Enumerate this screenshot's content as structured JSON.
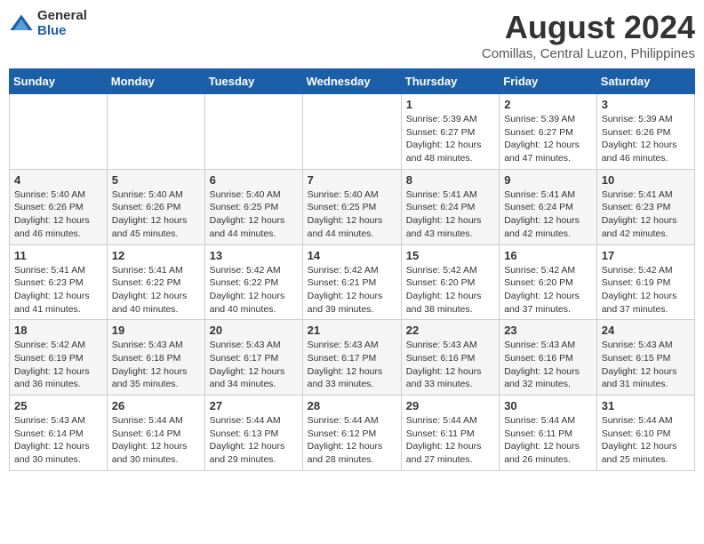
{
  "header": {
    "logo_general": "General",
    "logo_blue": "Blue",
    "main_title": "August 2024",
    "subtitle": "Comillas, Central Luzon, Philippines"
  },
  "calendar": {
    "days_of_week": [
      "Sunday",
      "Monday",
      "Tuesday",
      "Wednesday",
      "Thursday",
      "Friday",
      "Saturday"
    ],
    "weeks": [
      [
        {
          "day": "",
          "info": ""
        },
        {
          "day": "",
          "info": ""
        },
        {
          "day": "",
          "info": ""
        },
        {
          "day": "",
          "info": ""
        },
        {
          "day": "1",
          "info": "Sunrise: 5:39 AM\nSunset: 6:27 PM\nDaylight: 12 hours\nand 48 minutes."
        },
        {
          "day": "2",
          "info": "Sunrise: 5:39 AM\nSunset: 6:27 PM\nDaylight: 12 hours\nand 47 minutes."
        },
        {
          "day": "3",
          "info": "Sunrise: 5:39 AM\nSunset: 6:26 PM\nDaylight: 12 hours\nand 46 minutes."
        }
      ],
      [
        {
          "day": "4",
          "info": "Sunrise: 5:40 AM\nSunset: 6:26 PM\nDaylight: 12 hours\nand 46 minutes."
        },
        {
          "day": "5",
          "info": "Sunrise: 5:40 AM\nSunset: 6:26 PM\nDaylight: 12 hours\nand 45 minutes."
        },
        {
          "day": "6",
          "info": "Sunrise: 5:40 AM\nSunset: 6:25 PM\nDaylight: 12 hours\nand 44 minutes."
        },
        {
          "day": "7",
          "info": "Sunrise: 5:40 AM\nSunset: 6:25 PM\nDaylight: 12 hours\nand 44 minutes."
        },
        {
          "day": "8",
          "info": "Sunrise: 5:41 AM\nSunset: 6:24 PM\nDaylight: 12 hours\nand 43 minutes."
        },
        {
          "day": "9",
          "info": "Sunrise: 5:41 AM\nSunset: 6:24 PM\nDaylight: 12 hours\nand 42 minutes."
        },
        {
          "day": "10",
          "info": "Sunrise: 5:41 AM\nSunset: 6:23 PM\nDaylight: 12 hours\nand 42 minutes."
        }
      ],
      [
        {
          "day": "11",
          "info": "Sunrise: 5:41 AM\nSunset: 6:23 PM\nDaylight: 12 hours\nand 41 minutes."
        },
        {
          "day": "12",
          "info": "Sunrise: 5:41 AM\nSunset: 6:22 PM\nDaylight: 12 hours\nand 40 minutes."
        },
        {
          "day": "13",
          "info": "Sunrise: 5:42 AM\nSunset: 6:22 PM\nDaylight: 12 hours\nand 40 minutes."
        },
        {
          "day": "14",
          "info": "Sunrise: 5:42 AM\nSunset: 6:21 PM\nDaylight: 12 hours\nand 39 minutes."
        },
        {
          "day": "15",
          "info": "Sunrise: 5:42 AM\nSunset: 6:20 PM\nDaylight: 12 hours\nand 38 minutes."
        },
        {
          "day": "16",
          "info": "Sunrise: 5:42 AM\nSunset: 6:20 PM\nDaylight: 12 hours\nand 37 minutes."
        },
        {
          "day": "17",
          "info": "Sunrise: 5:42 AM\nSunset: 6:19 PM\nDaylight: 12 hours\nand 37 minutes."
        }
      ],
      [
        {
          "day": "18",
          "info": "Sunrise: 5:42 AM\nSunset: 6:19 PM\nDaylight: 12 hours\nand 36 minutes."
        },
        {
          "day": "19",
          "info": "Sunrise: 5:43 AM\nSunset: 6:18 PM\nDaylight: 12 hours\nand 35 minutes."
        },
        {
          "day": "20",
          "info": "Sunrise: 5:43 AM\nSunset: 6:17 PM\nDaylight: 12 hours\nand 34 minutes."
        },
        {
          "day": "21",
          "info": "Sunrise: 5:43 AM\nSunset: 6:17 PM\nDaylight: 12 hours\nand 33 minutes."
        },
        {
          "day": "22",
          "info": "Sunrise: 5:43 AM\nSunset: 6:16 PM\nDaylight: 12 hours\nand 33 minutes."
        },
        {
          "day": "23",
          "info": "Sunrise: 5:43 AM\nSunset: 6:16 PM\nDaylight: 12 hours\nand 32 minutes."
        },
        {
          "day": "24",
          "info": "Sunrise: 5:43 AM\nSunset: 6:15 PM\nDaylight: 12 hours\nand 31 minutes."
        }
      ],
      [
        {
          "day": "25",
          "info": "Sunrise: 5:43 AM\nSunset: 6:14 PM\nDaylight: 12 hours\nand 30 minutes."
        },
        {
          "day": "26",
          "info": "Sunrise: 5:44 AM\nSunset: 6:14 PM\nDaylight: 12 hours\nand 30 minutes."
        },
        {
          "day": "27",
          "info": "Sunrise: 5:44 AM\nSunset: 6:13 PM\nDaylight: 12 hours\nand 29 minutes."
        },
        {
          "day": "28",
          "info": "Sunrise: 5:44 AM\nSunset: 6:12 PM\nDaylight: 12 hours\nand 28 minutes."
        },
        {
          "day": "29",
          "info": "Sunrise: 5:44 AM\nSunset: 6:11 PM\nDaylight: 12 hours\nand 27 minutes."
        },
        {
          "day": "30",
          "info": "Sunrise: 5:44 AM\nSunset: 6:11 PM\nDaylight: 12 hours\nand 26 minutes."
        },
        {
          "day": "31",
          "info": "Sunrise: 5:44 AM\nSunset: 6:10 PM\nDaylight: 12 hours\nand 25 minutes."
        }
      ]
    ]
  }
}
